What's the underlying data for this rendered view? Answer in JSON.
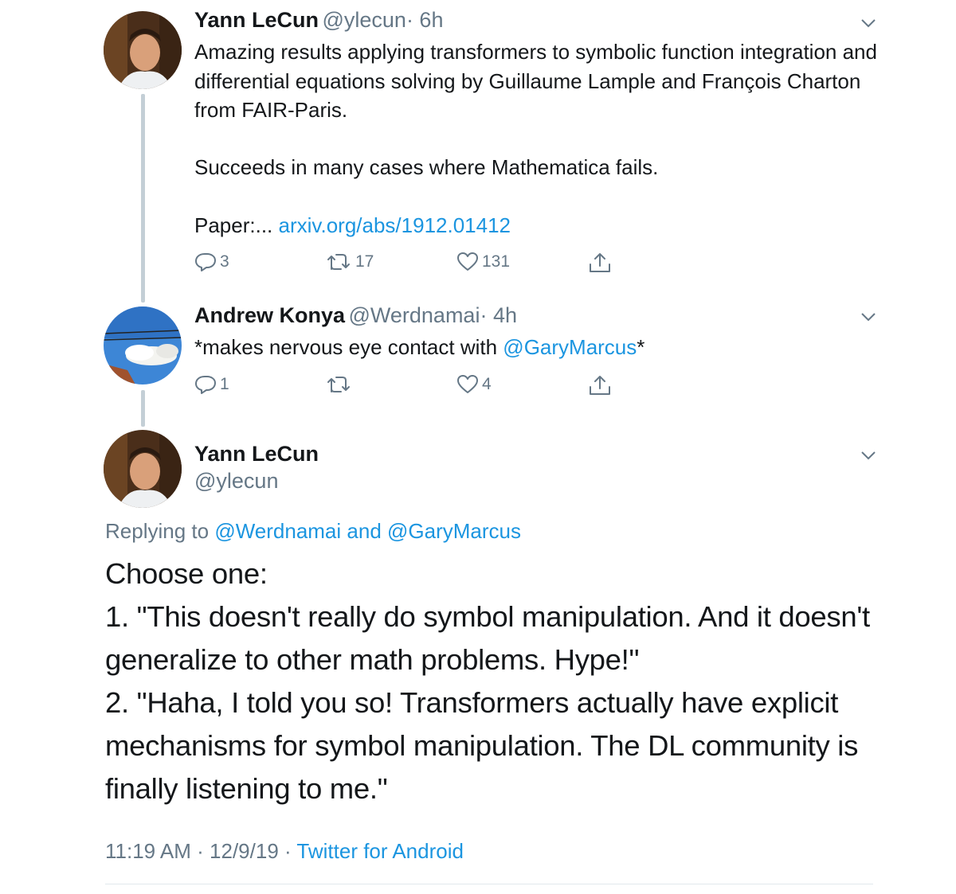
{
  "tweet1": {
    "name": "Yann LeCun",
    "handle": "@ylecun",
    "time": "· 6h",
    "text": "Amazing results applying transformers to symbolic function integration and differential equations solving by Guillaume Lample and François Charton from FAIR-Paris.",
    "text2": "Succeeds in many cases where Mathematica fails.",
    "paper_prefix": "Paper:...",
    "paper_link": "arxiv.org/abs/1912.01412",
    "replies": "3",
    "retweets": "17",
    "likes": "131"
  },
  "tweet2": {
    "name": "Andrew Konya",
    "handle": "@Werdnamai",
    "time": "· 4h",
    "text_prefix": "*makes nervous eye contact with ",
    "mention": "@GaryMarcus",
    "text_suffix": "*",
    "replies": "1",
    "retweets": "",
    "likes": "4"
  },
  "main_tweet": {
    "name": "Yann LeCun",
    "handle": "@ylecun",
    "replying_label": "Replying to",
    "replying_to": "@Werdnamai and @GaryMarcus",
    "line1": "Choose one:",
    "line2": "1. \"This doesn't really do symbol manipulation. And it doesn't",
    "line3": "generalize to other math problems. Hype!\"",
    "line4": "2. \"Haha, I told you so! Transformers actually have explicit",
    "line5": "mechanisms for symbol manipulation. The DL community is",
    "line6": "finally listening to me.\"",
    "timestamp": "11:19 AM · 12/9/19 · ",
    "source": "Twitter for Android"
  },
  "icons": {
    "reply": "reply-icon",
    "retweet": "retweet-icon",
    "like": "heart-icon",
    "share": "share-icon",
    "more": "chevron-down-icon"
  },
  "colors": {
    "link": "#1b95e0",
    "secondary": "#657786",
    "thread_line": "#c4cfd6"
  }
}
